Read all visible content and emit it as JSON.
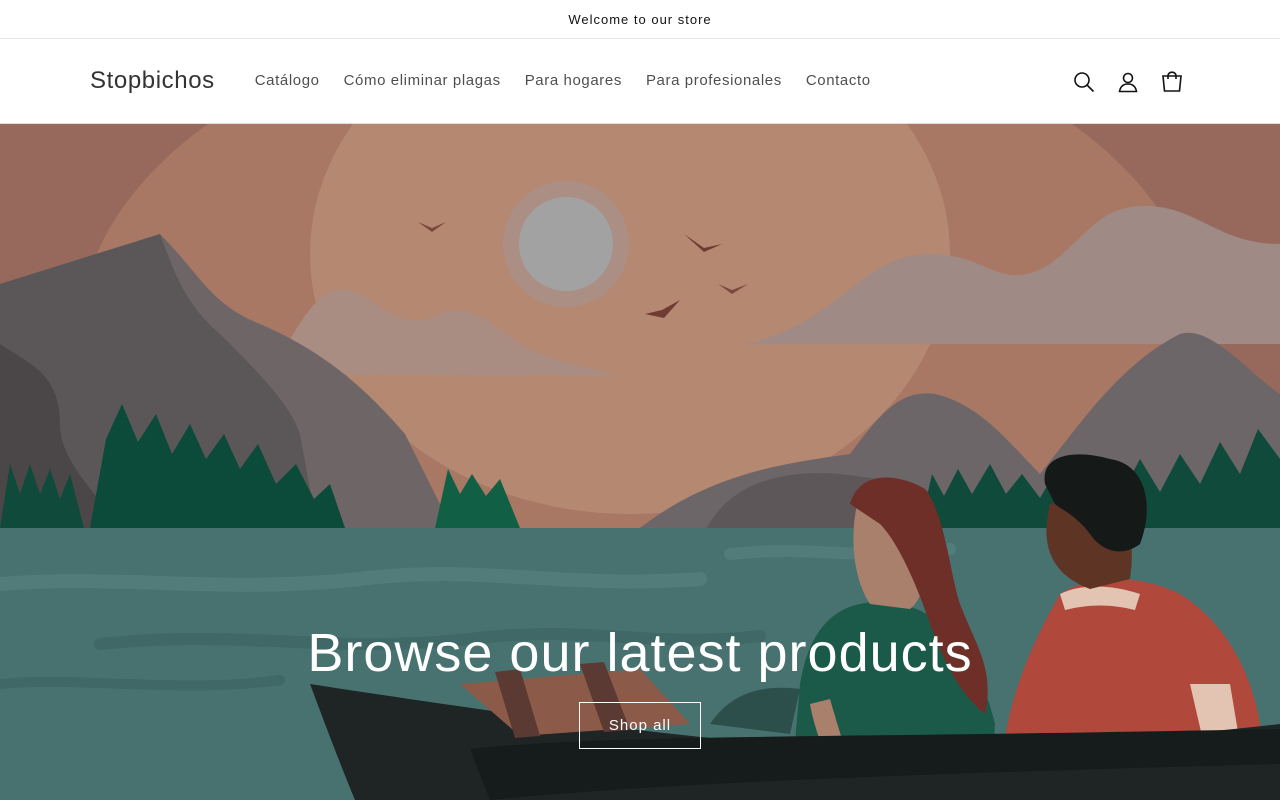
{
  "announcement": {
    "text": "Welcome to our store"
  },
  "header": {
    "logo": "Stopbichos",
    "nav": [
      {
        "label": "Catálogo"
      },
      {
        "label": "Cómo eliminar plagas"
      },
      {
        "label": "Para hogares"
      },
      {
        "label": "Para profesionales"
      },
      {
        "label": "Contacto"
      }
    ],
    "icons": [
      "search-icon",
      "account-icon",
      "cart-icon"
    ]
  },
  "hero": {
    "title": "Browse our latest products",
    "button_label": "Shop all"
  },
  "colors": {
    "text": "#121212",
    "border": "#e6e6e6",
    "sky": "#c98a6c",
    "water": "#4a7572"
  }
}
